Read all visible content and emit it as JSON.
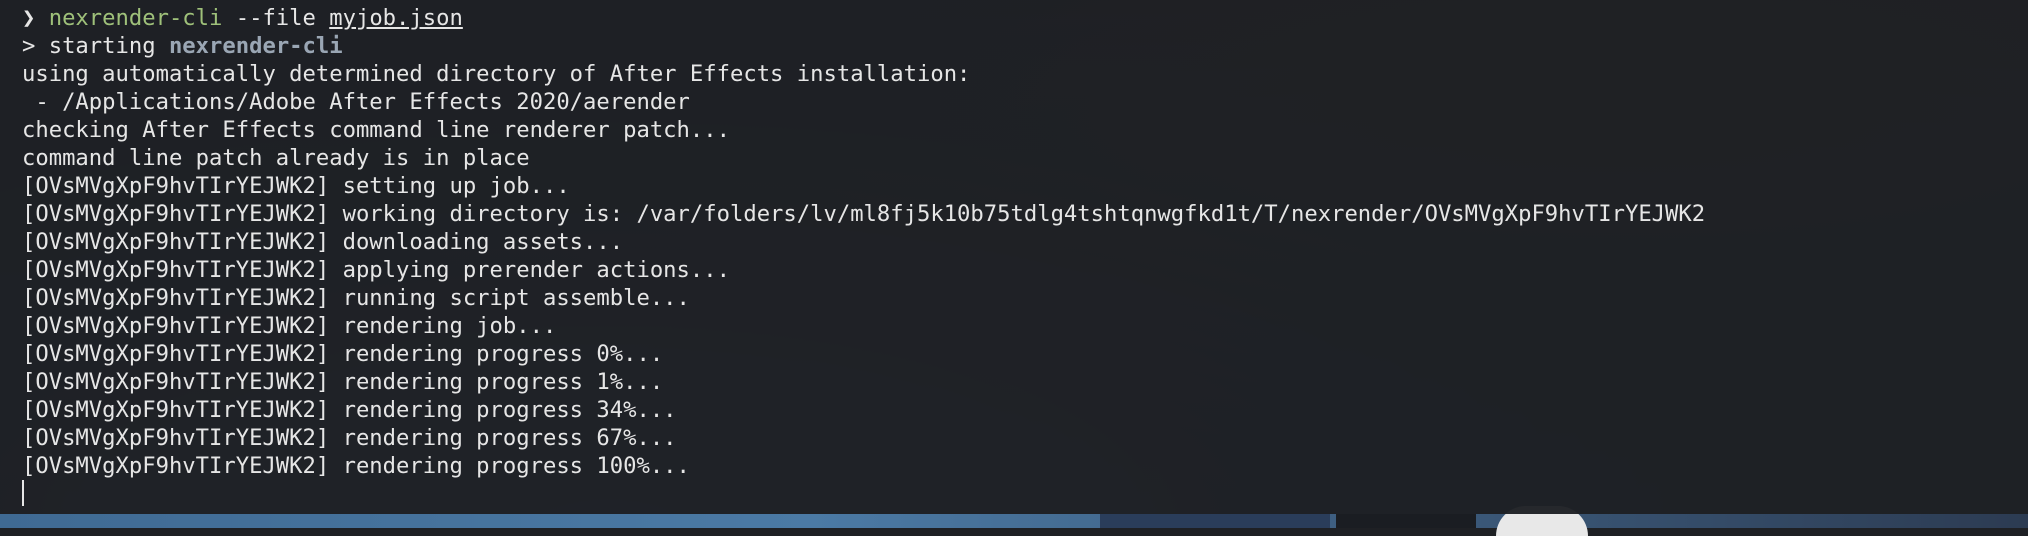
{
  "terminal": {
    "command": {
      "prompt": "❯",
      "program": "nexrender-cli",
      "flag": "--file",
      "file": "myjob.json"
    },
    "starting": {
      "prefix": "> starting ",
      "app": "nexrender-cli"
    },
    "output_lines": [
      "using automatically determined directory of After Effects installation:",
      " - /Applications/Adobe After Effects 2020/aerender",
      "checking After Effects command line renderer patch...",
      "command line patch already is in place",
      "[OVsMVgXpF9hvTIrYEJWK2] setting up job...",
      "[OVsMVgXpF9hvTIrYEJWK2] working directory is: /var/folders/lv/ml8fj5k10b75tdlg4tshtqnwgfkd1t/T/nexrender/OVsMVgXpF9hvTIrYEJWK2",
      "[OVsMVgXpF9hvTIrYEJWK2] downloading assets...",
      "[OVsMVgXpF9hvTIrYEJWK2] applying prerender actions...",
      "[OVsMVgXpF9hvTIrYEJWK2] running script assemble...",
      "[OVsMVgXpF9hvTIrYEJWK2] rendering job...",
      "[OVsMVgXpF9hvTIrYEJWK2] rendering progress 0%...",
      "[OVsMVgXpF9hvTIrYEJWK2] rendering progress 1%...",
      "[OVsMVgXpF9hvTIrYEJWK2] rendering progress 34%...",
      "[OVsMVgXpF9hvTIrYEJWK2] rendering progress 67%...",
      "[OVsMVgXpF9hvTIrYEJWK2] rendering progress 100%..."
    ]
  },
  "colors": {
    "background": "#1e2024",
    "text": "#e6e6e6",
    "command": "#9fc17a",
    "app_name": "#9aa6b4"
  }
}
